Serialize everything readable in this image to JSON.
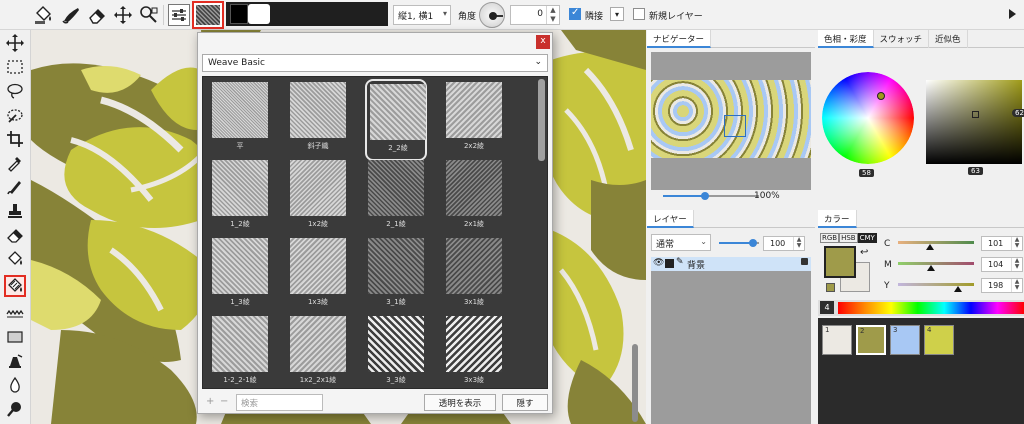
{
  "toolbar": {
    "fill_mode_icon": "bucket-icon",
    "pattern_name": "2_2綾",
    "repeat_select": "縦1, 横1",
    "angle_label": "角度",
    "angle_value": "0",
    "adjacent_label": "隣接",
    "adjacent_checked": true,
    "new_layer_label": "新規レイヤー",
    "new_layer_checked": false
  },
  "dialog": {
    "set_name": "Weave Basic",
    "close_label": "x",
    "patterns": [
      {
        "name": "平",
        "pitch": 2.2,
        "angle": 45,
        "contrast": "light"
      },
      {
        "name": "斜子織",
        "pitch": 3.2,
        "angle": 45,
        "contrast": "light"
      },
      {
        "name": "2_2綾",
        "pitch": 4.0,
        "angle": 45,
        "contrast": "light",
        "selected": true
      },
      {
        "name": "2x2綾",
        "pitch": 4.0,
        "angle": -45,
        "contrast": "light"
      },
      {
        "name": "1_2綾",
        "pitch": 3.2,
        "angle": 45,
        "contrast": "light"
      },
      {
        "name": "1x2綾",
        "pitch": 3.2,
        "angle": -45,
        "contrast": "light"
      },
      {
        "name": "2_1綾",
        "pitch": 3.2,
        "angle": 45,
        "contrast": "dark"
      },
      {
        "name": "2x1綾",
        "pitch": 3.2,
        "angle": -45,
        "contrast": "dark"
      },
      {
        "name": "1_3綾",
        "pitch": 3.6,
        "angle": 45,
        "contrast": "light"
      },
      {
        "name": "1x3綾",
        "pitch": 3.6,
        "angle": -45,
        "contrast": "light"
      },
      {
        "name": "3_1綾",
        "pitch": 3.6,
        "angle": 45,
        "contrast": "dark"
      },
      {
        "name": "3x1綾",
        "pitch": 3.6,
        "angle": -45,
        "contrast": "dark"
      },
      {
        "name": "1-2_2-1綾",
        "pitch": 4.0,
        "angle": 45,
        "contrast": "light"
      },
      {
        "name": "1x2_2x1綾",
        "pitch": 4.0,
        "angle": -45,
        "contrast": "light"
      },
      {
        "name": "3_3綾",
        "pitch": 5.0,
        "angle": 45,
        "contrast": "bold"
      },
      {
        "name": "3x3綾",
        "pitch": 5.0,
        "angle": -45,
        "contrast": "bold"
      }
    ],
    "search_placeholder": "検索",
    "show_transparent_label": "透明を表示",
    "hide_label": "隠す",
    "add_label": "+",
    "remove_label": "−"
  },
  "navigator": {
    "tab_label": "ナビゲーター",
    "zoom_level": "100%"
  },
  "layers": {
    "tab_label": "レイヤー",
    "blend_mode": "通常",
    "opacity": "100",
    "items": [
      {
        "name": "背景",
        "locked": true,
        "visible": true
      }
    ]
  },
  "color": {
    "tabs": [
      "色相・彩度",
      "スウォッチ",
      "近似色"
    ],
    "active_tab": 0,
    "hue_value": "58",
    "brightness_value": "63",
    "saturation_value": "62"
  },
  "color_mixer": {
    "tab_label": "カラー",
    "modes": [
      "RGB",
      "HSB",
      "CMY"
    ],
    "active_mode": "CMY",
    "channels": [
      {
        "label": "C",
        "value": "101"
      },
      {
        "label": "M",
        "value": "104"
      },
      {
        "label": "Y",
        "value": "198"
      }
    ]
  },
  "palette": {
    "count_label": "4",
    "items": [
      {
        "num": "1",
        "color": "#ece9e3"
      },
      {
        "num": "2",
        "color": "#9f9b4a"
      },
      {
        "num": "3",
        "color": "#a8c8f4"
      },
      {
        "num": "4",
        "color": "#cfd04a"
      }
    ]
  },
  "colors": {
    "accent": "#3b86d7",
    "highlight": "#e22d22",
    "foreground": "#9f9b4a",
    "background": "#ece9e3",
    "leaf_olive": "#878338",
    "leaf_lime": "#c6c53e",
    "leaf_pale": "#dedb6e"
  }
}
